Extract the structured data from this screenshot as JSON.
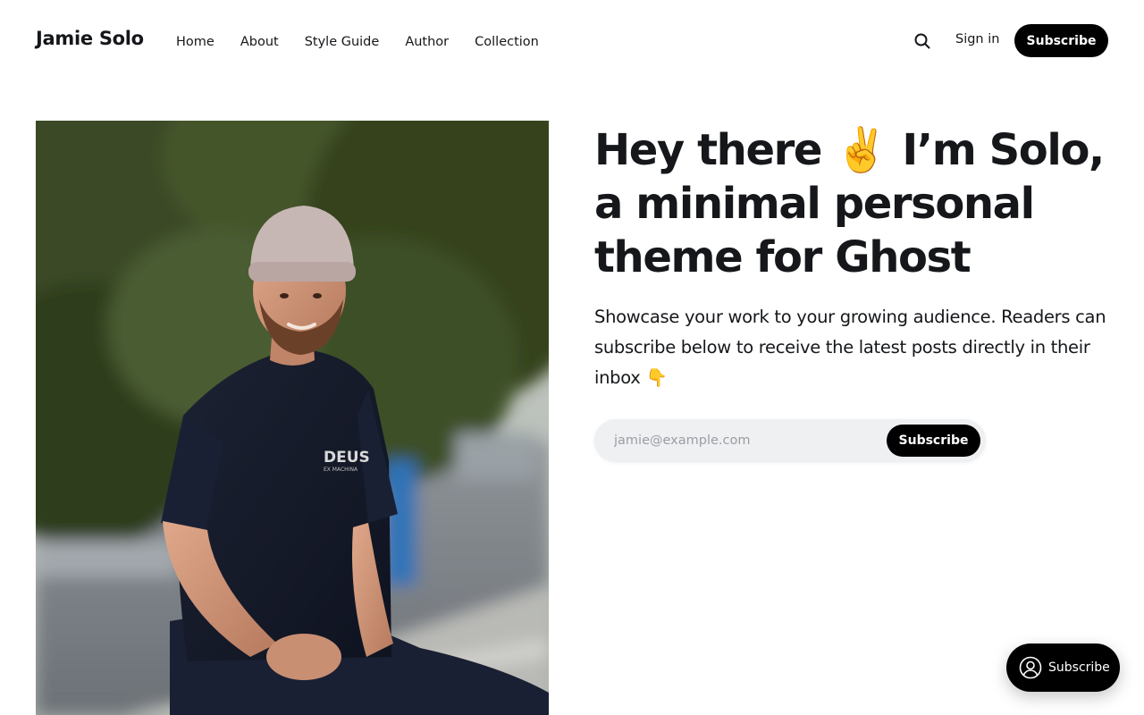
{
  "header": {
    "brand": "Jamie Solo",
    "nav": [
      {
        "label": "Home"
      },
      {
        "label": "About"
      },
      {
        "label": "Style Guide"
      },
      {
        "label": "Author"
      },
      {
        "label": "Collection"
      }
    ],
    "search_icon": "search-icon",
    "signin_label": "Sign in",
    "subscribe_label": "Subscribe"
  },
  "hero": {
    "title_part1": "Hey there ",
    "title_emoji": "✌️",
    "title_part2": " I’m Solo, a minimal personal theme for Ghost",
    "description": "Showcase your work to your growing audience. Readers can subscribe below to receive the latest posts directly in their inbox",
    "description_emoji": "👇",
    "image_icon": "portrait-photo"
  },
  "form": {
    "email_placeholder": "jamie@example.com",
    "submit_label": "Subscribe"
  },
  "portal": {
    "icon": "user-circle-icon",
    "label": "Subscribe"
  },
  "colors": {
    "accent": "#000000",
    "text": "#15171a",
    "form_bg": "#eef0f2"
  }
}
